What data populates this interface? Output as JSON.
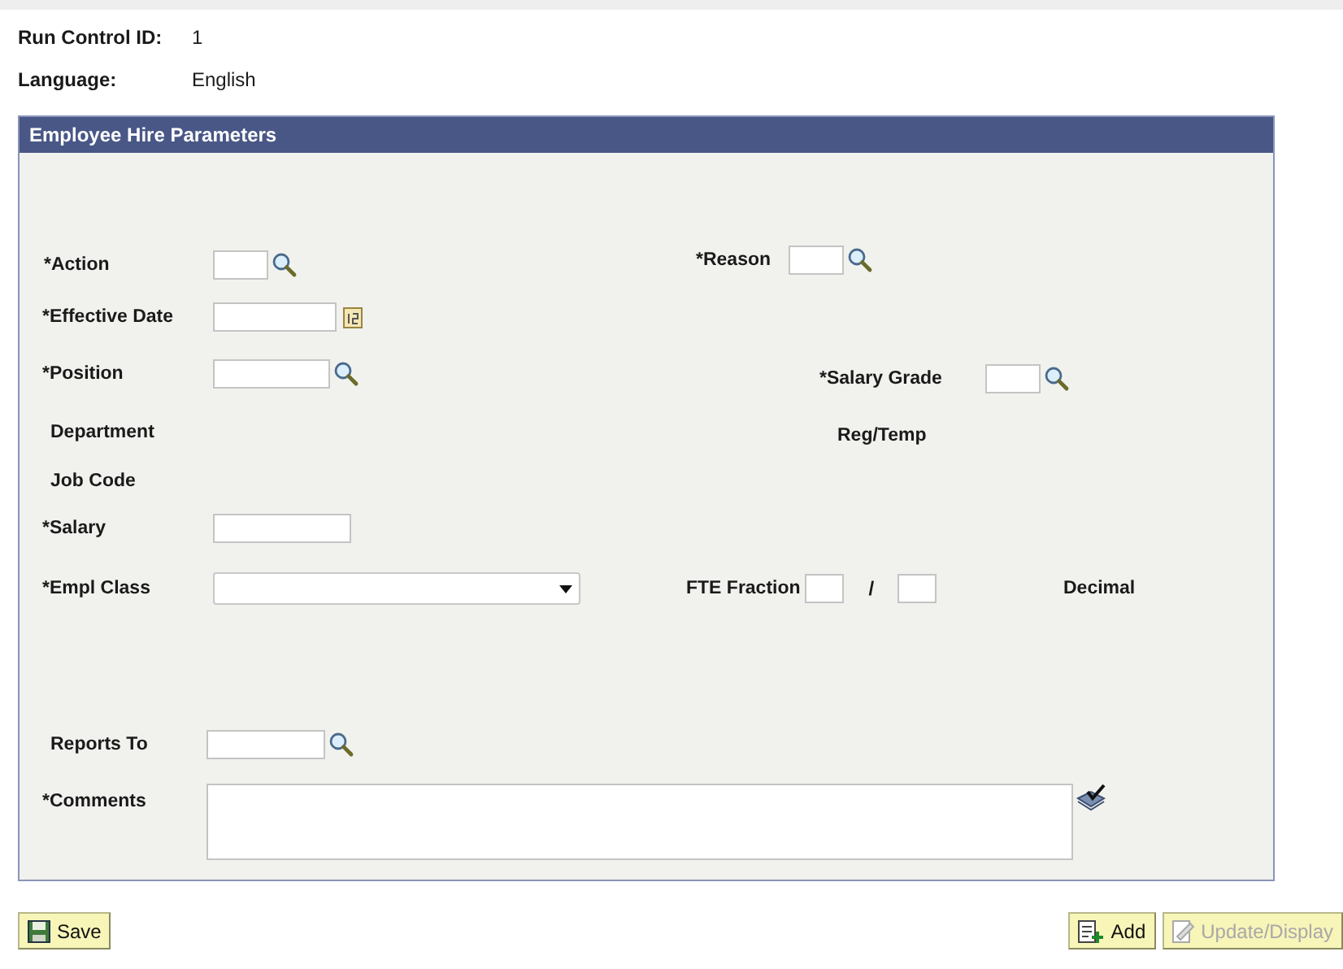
{
  "run_control": {
    "label": "Run Control ID:",
    "value": "1"
  },
  "language": {
    "label": "Language:",
    "value": "English"
  },
  "panel": {
    "title": "Employee Hire Parameters",
    "rows": [
      {
        "fields": [
          {
            "kind": "lookup",
            "label": "*Action"
          },
          {
            "kind": "lookup",
            "label": "*Reason"
          }
        ]
      },
      {
        "fields": [
          {
            "kind": "date",
            "label": "*Effective Date"
          }
        ]
      },
      {
        "fields": [
          {
            "kind": "lookup",
            "label": "*Position"
          },
          {
            "kind": "lookup",
            "label": "*Salary Grade"
          }
        ]
      },
      {
        "fields": [
          {
            "kind": "display",
            "label": "Department"
          },
          {
            "kind": "display",
            "label": "Reg/Temp"
          }
        ]
      },
      {
        "fields": [
          {
            "kind": "display",
            "label": "Job Code"
          }
        ]
      },
      {
        "fields": [
          {
            "kind": "text",
            "label": "*Salary"
          }
        ]
      },
      {
        "fields": [
          {
            "kind": "select",
            "label": "*Empl Class"
          },
          {
            "kind": "fraction",
            "label": "FTE Fraction",
            "separator": "/"
          },
          {
            "kind": "display",
            "label": "Decimal"
          }
        ]
      },
      {
        "fields": [
          {
            "kind": "lookup",
            "label": "Reports To"
          }
        ]
      },
      {
        "fields": [
          {
            "kind": "textarea",
            "label": "*Comments"
          }
        ]
      }
    ]
  },
  "buttons": [
    {
      "kind": "save",
      "label": "Save",
      "disabled": false
    },
    {
      "kind": "add",
      "label": "Add",
      "disabled": false
    },
    {
      "kind": "update",
      "label": "Update/Display",
      "disabled": true
    }
  ]
}
